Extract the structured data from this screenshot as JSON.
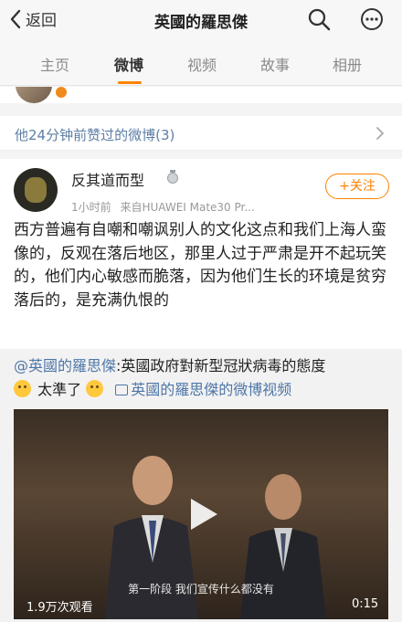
{
  "header": {
    "back_label": "返回",
    "title": "英國的羅思傑",
    "icons": [
      "chevron-left-icon",
      "search-icon",
      "more-icon"
    ]
  },
  "tabs": [
    {
      "label": "主页",
      "active": false
    },
    {
      "label": "微博",
      "active": true
    },
    {
      "label": "视频",
      "active": false
    },
    {
      "label": "故事",
      "active": false
    },
    {
      "label": "相册",
      "active": false
    }
  ],
  "liked_bar": {
    "label": "他24分钟前赞过的微博(3)"
  },
  "post": {
    "username": "反其道而型",
    "time": "1小时前",
    "source": "来自HUAWEI Mate30 Pr...",
    "follow_label": "+关注",
    "body": "西方普遍有自嘲和嘲讽别人的文化这点和我们上海人蛮像的，反观在落后地区，那里人过于严肃是开不起玩笑的，他们内心敏感而脆落，因为他们生长的环境是贫穷落后的，是充满仇恨的"
  },
  "repost": {
    "at_user": "@英國的羅思傑",
    "text": ":英國政府對新型冠狀病毒的態度",
    "text2": "太準了",
    "video_link": "英國的羅思傑的微博视频",
    "video": {
      "subtitle": "第一阶段 我们宣传什么都没有",
      "views": "1.9万次观看",
      "duration": "0:15"
    }
  },
  "colors": {
    "accent": "#ff8200",
    "link": "#4e76a8",
    "liked": "#5d7ea6"
  }
}
